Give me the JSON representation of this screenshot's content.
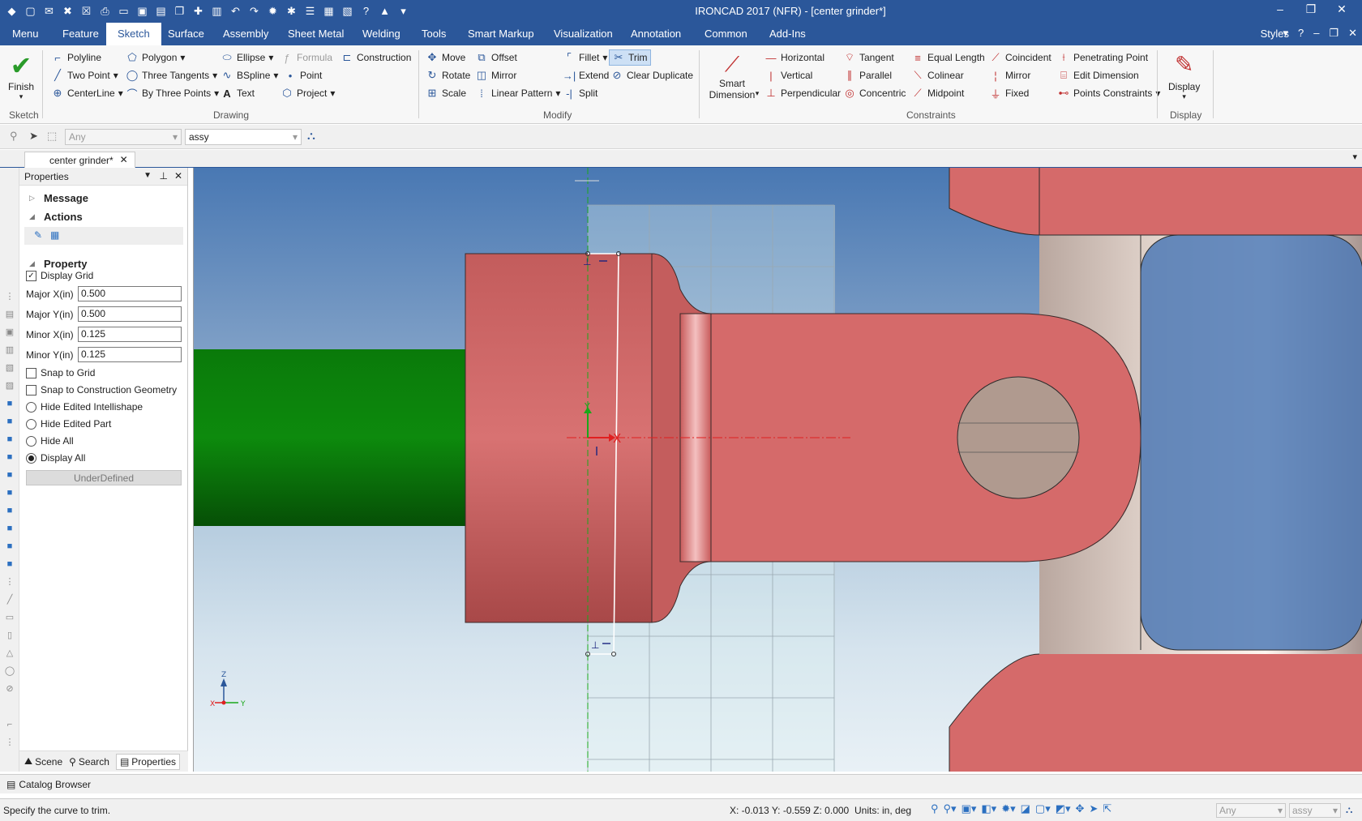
{
  "window": {
    "title": "IRONCAD 2017 (NFR) - [center grinder*]"
  },
  "menu": {
    "tabs": [
      "Menu",
      "Feature",
      "Sketch",
      "Surface",
      "Assembly",
      "Sheet Metal",
      "Welding",
      "Tools",
      "Smart Markup",
      "Visualization",
      "Annotation",
      "Common",
      "Add-Ins"
    ],
    "active": "Sketch",
    "styles": "Styles"
  },
  "ribbon": {
    "finish": "Finish",
    "groups": {
      "sketch": "Sketch",
      "drawing": "Drawing",
      "modify": "Modify",
      "constraints": "Constraints",
      "display": "Display"
    },
    "drawing": {
      "polyline": "Polyline",
      "polygon": "Polygon",
      "ellipse": "Ellipse",
      "formula": "Formula",
      "construction": "Construction",
      "two_point": "Two Point",
      "three_tangents": "Three Tangents",
      "bspline": "BSpline",
      "point": "Point",
      "centerline": "CenterLine",
      "by_three_points": "By Three Points",
      "text": "Text",
      "project": "Project"
    },
    "modify": {
      "move": "Move",
      "offset": "Offset",
      "fillet": "Fillet",
      "trim": "Trim",
      "rotate": "Rotate",
      "mirror": "Mirror",
      "extend": "Extend",
      "clear_duplicate": "Clear Duplicate",
      "scale": "Scale",
      "linear_pattern": "Linear Pattern",
      "split": "Split"
    },
    "constraints": {
      "smart_dimension": "Smart\nDimension",
      "horizontal": "Horizontal",
      "tangent": "Tangent",
      "equal_length": "Equal Length",
      "coincident": "Coincident",
      "penetrating_point": "Penetrating Point",
      "vertical": "Vertical",
      "parallel": "Parallel",
      "colinear": "Colinear",
      "mirror": "Mirror",
      "edit_dimension": "Edit Dimension",
      "perpendicular": "Perpendicular",
      "concentric": "Concentric",
      "midpoint": "Midpoint",
      "fixed": "Fixed",
      "points_constraints": "Points Constraints"
    },
    "display": "Display"
  },
  "toolbar2": {
    "filter_value": "Any",
    "assy_value": "assy"
  },
  "doc_tab": "center grinder*",
  "properties": {
    "header": "Properties",
    "sections": {
      "message": "Message",
      "actions": "Actions",
      "property": "Property"
    },
    "display_grid": "Display Grid",
    "display_grid_checked": true,
    "fields": [
      {
        "label": "Major X(in)",
        "value": "0.500"
      },
      {
        "label": "Major Y(in)",
        "value": "0.500"
      },
      {
        "label": "Minor X(in)",
        "value": "0.125"
      },
      {
        "label": "Minor Y(in)",
        "value": "0.125"
      }
    ],
    "snap_grid": "Snap to Grid",
    "snap_construction": "Snap to Construction Geometry",
    "radios": [
      "Hide Edited Intellishape",
      "Hide Edited Part",
      "Hide All",
      "Display All"
    ],
    "radio_selected": "Display All",
    "underdefined": "UnderDefined",
    "bottom_tabs": [
      "Scene",
      "Search",
      "Properties"
    ]
  },
  "viewport": {
    "axis_labels": {
      "z": "Z",
      "x": "X",
      "y": "Y"
    }
  },
  "catalog": "Catalog Browser",
  "status": {
    "message": "Specify the curve to trim.",
    "coords": "X: -0.013 Y: -0.559 Z: 0.000",
    "units": "Units: in, deg",
    "filter_value": "Any",
    "assy_value": "assy"
  },
  "colors": {
    "accent": "#2b579a",
    "part_red": "#d56a6a",
    "shaft_green": "#0b6d0b",
    "sketch_red": "#e02020"
  }
}
